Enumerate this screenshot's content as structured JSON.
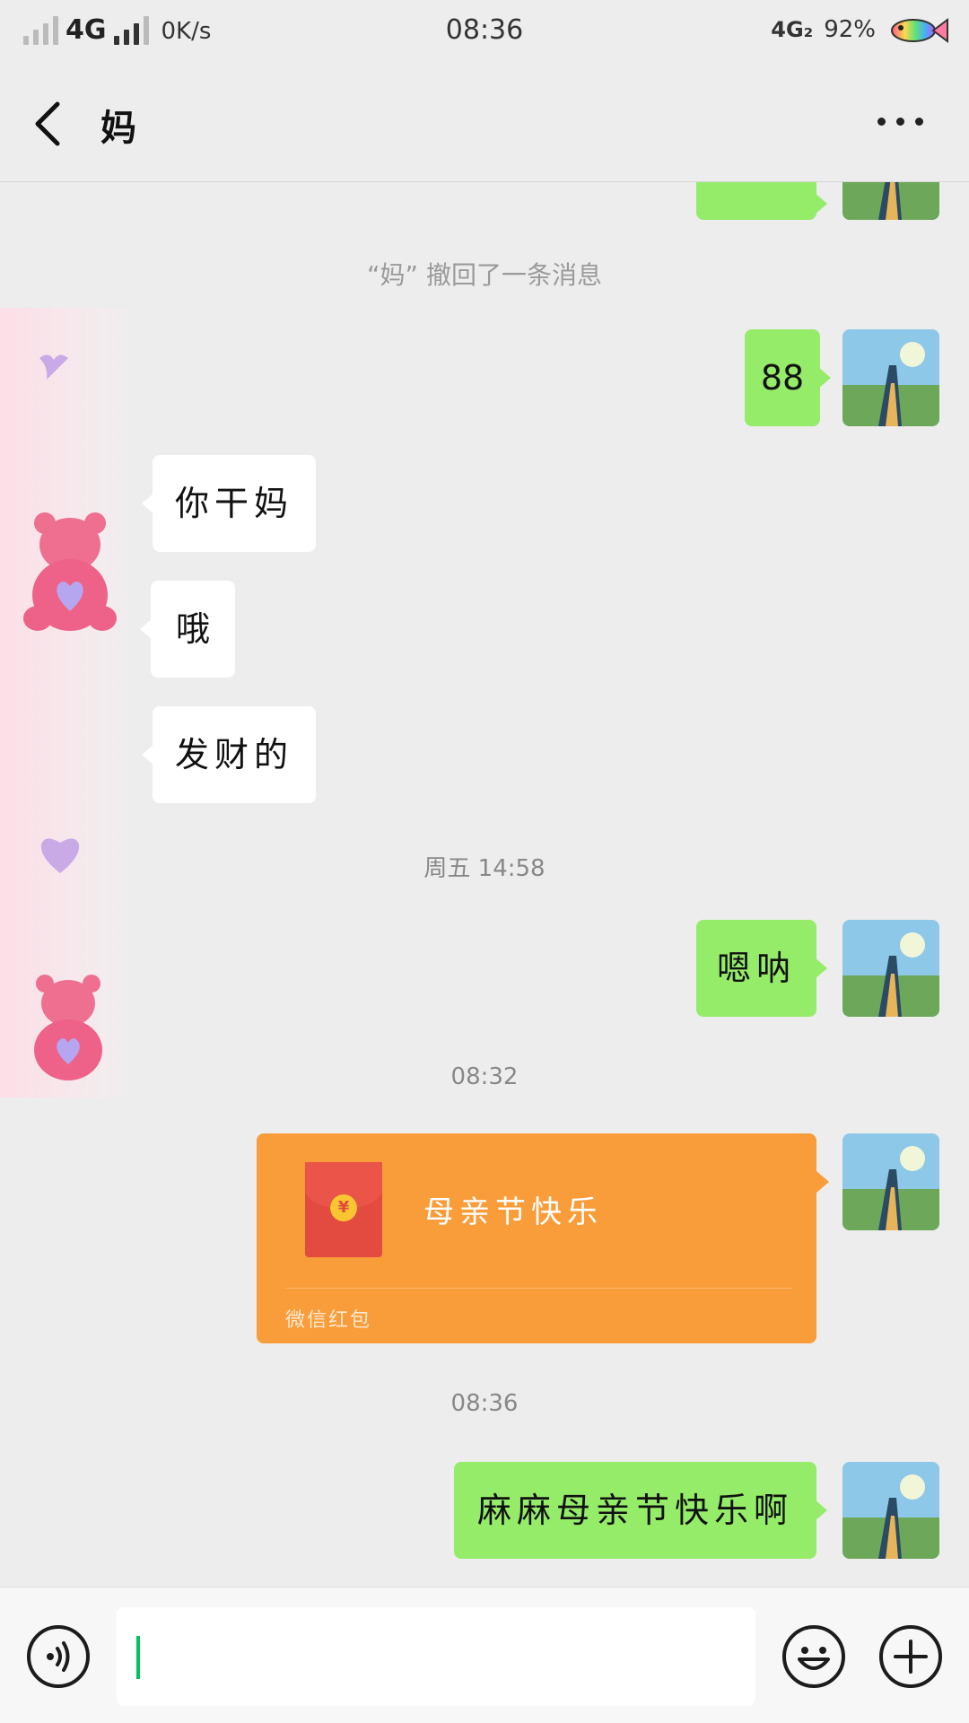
{
  "status_bar": {
    "network": "4G",
    "speed": "0K/s",
    "time": "08:36",
    "network2": "4G₂",
    "battery": "92%"
  },
  "header": {
    "title": "妈",
    "back_icon": "chevron-left-icon",
    "more_icon": "more-icon"
  },
  "messages": {
    "recall_notice": "“妈” 撤回了一条消息",
    "out_88": "88",
    "in_1": "你干妈",
    "in_2": "哦",
    "in_3": "发财的",
    "ts_1": "周五 14:58",
    "out_2": "嗯呐",
    "ts_2": "08:32",
    "ts_3": "08:36",
    "out_3": "麻麻母亲节快乐啊"
  },
  "red_packet": {
    "title": "母亲节快乐",
    "label": "微信红包",
    "coin": "¥"
  },
  "input_bar": {
    "voice_icon": "voice-icon",
    "emoji_icon": "emoji-icon",
    "plus_icon": "plus-icon",
    "value": ""
  },
  "colors": {
    "outgoing_bubble": "#95ec69",
    "incoming_bubble": "#ffffff",
    "red_packet": "#f89d3a",
    "background": "#ededed"
  }
}
